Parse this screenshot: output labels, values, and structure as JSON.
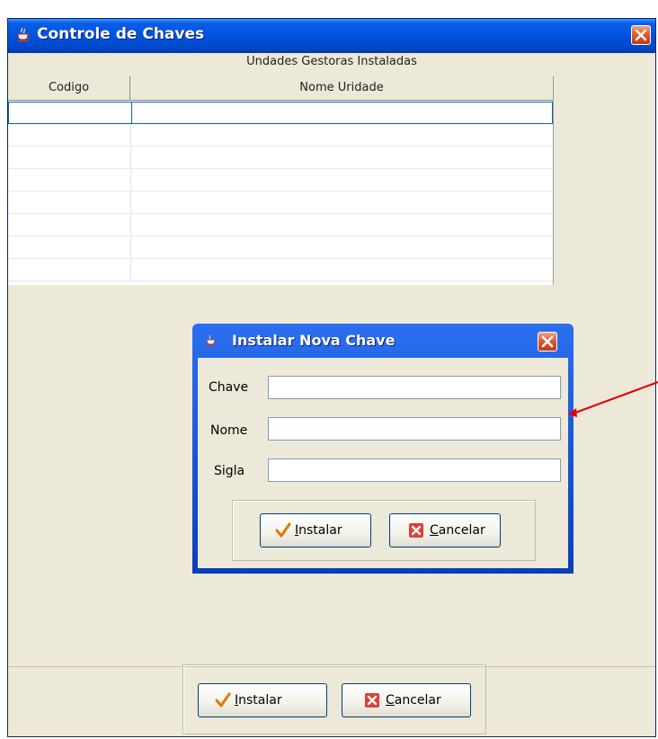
{
  "main_window": {
    "title": "Controle de Chaves",
    "table_caption": "Undades Gestoras Instaladas",
    "table": {
      "columns": [
        "Codigo",
        "Nome Uridade"
      ],
      "rows": [
        [
          "",
          ""
        ],
        [
          "",
          ""
        ],
        [
          "",
          ""
        ],
        [
          "",
          ""
        ],
        [
          "",
          ""
        ],
        [
          "",
          ""
        ],
        [
          "",
          ""
        ],
        [
          "",
          ""
        ]
      ]
    },
    "footer": {
      "install_label_mn": "I",
      "install_label_rest": "nstalar",
      "cancel_label_mn": "C",
      "cancel_label_rest": "ancelar"
    }
  },
  "dialog": {
    "title": "Instalar Nova Chave",
    "fields": {
      "chave_label": "Chave",
      "chave_value": "",
      "nome_label": "Nome",
      "nome_value": "",
      "sigla_label": "Sigla",
      "sigla_value": ""
    },
    "buttons": {
      "install_label_mn": "I",
      "install_label_rest": "nstalar",
      "cancel_label_mn": "C",
      "cancel_label_rest": "ancelar"
    }
  },
  "colors": {
    "titlebar": "#0054e3",
    "window_bg": "#ece9d8",
    "close_red": "#e25b2f",
    "annotation_arrow": "#e00000",
    "selection_border": "#0a64ad"
  },
  "icons": {
    "app": "java-cup-icon",
    "close": "close-icon",
    "install": "checkmark-icon",
    "cancel": "cancel-x-icon"
  }
}
